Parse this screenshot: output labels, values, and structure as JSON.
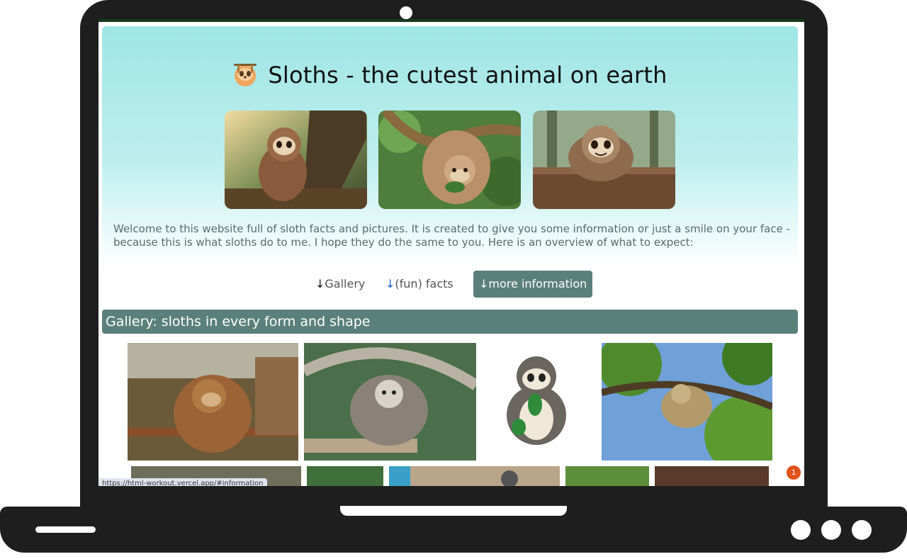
{
  "page": {
    "title": "Sloths - the cutest animal on earth",
    "intro": "Welcome to this website full of sloth facts and pictures. It is created to give you some information or just a smile on your face - because this is what sloths do to me. I hope they do the same to you. Here is an overview of what to expect:"
  },
  "nav": {
    "items": [
      {
        "arrow": "↓",
        "label": "Gallery"
      },
      {
        "arrow": "↓",
        "label": "(fun) facts"
      },
      {
        "arrow": "↓",
        "label": "more information"
      }
    ]
  },
  "gallery": {
    "heading": "Gallery: sloths in every form and shape"
  },
  "status": {
    "url": "https://html-workout.vercel.app/#information"
  },
  "notification": {
    "count": "1"
  },
  "colors": {
    "accent": "#5a807b",
    "hero_top": "#9fe6e5",
    "link_arrow": "#1d63c9",
    "notification": "#e0531b"
  }
}
